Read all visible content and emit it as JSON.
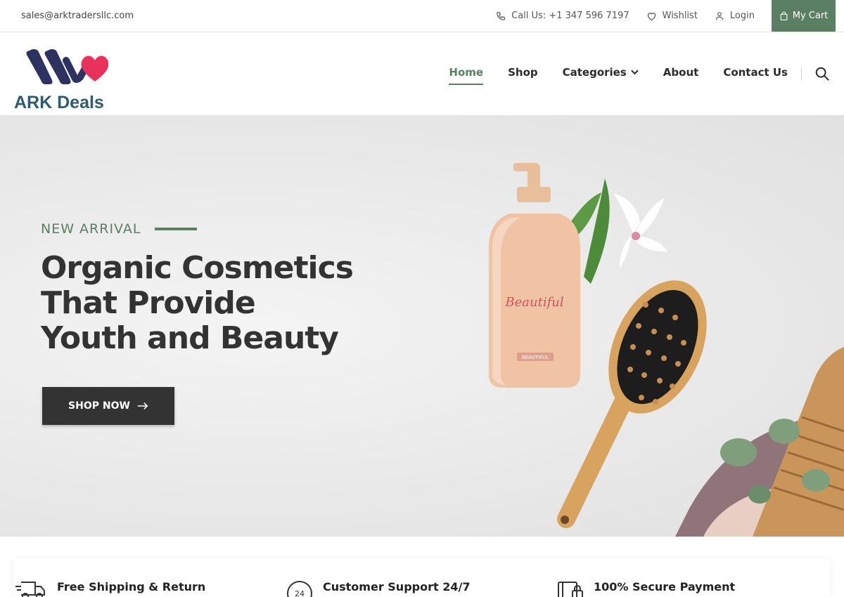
{
  "topbar": {
    "email": "sales@arktradersllc.com",
    "phone_label": "Call Us: +1 347 596 7197",
    "wishlist_label": "Wishlist",
    "login_label": "Login",
    "cart_label": "My Cart"
  },
  "brand": {
    "name": "ARK Deals",
    "colors": {
      "accent": "#5b7f62",
      "logo_navy": "#2e3260",
      "logo_heart": "#e8315b",
      "brand_text": "#2f5b6e"
    }
  },
  "nav": {
    "items": [
      {
        "label": "Home",
        "active": true
      },
      {
        "label": "Shop",
        "active": false
      },
      {
        "label": "Categories",
        "active": false,
        "has_dropdown": true
      },
      {
        "label": "About",
        "active": false
      },
      {
        "label": "Contact Us",
        "active": false
      }
    ]
  },
  "hero": {
    "eyebrow": "NEW ARRIVAL",
    "headline_line1": "Organic Cosmetics",
    "headline_line2": "That Provide",
    "headline_line3": "Youth and Beauty",
    "cta_label": "SHOP NOW",
    "bottle_script": "Beautiful",
    "bottle_tag": "BEAUTIFUL"
  },
  "features": [
    {
      "icon": "delivery-truck-icon",
      "title": "Free Shipping & Return"
    },
    {
      "icon": "support-24-icon",
      "title": "Customer Support 24/7"
    },
    {
      "icon": "secure-payment-icon",
      "title": "100% Secure Payment"
    }
  ]
}
